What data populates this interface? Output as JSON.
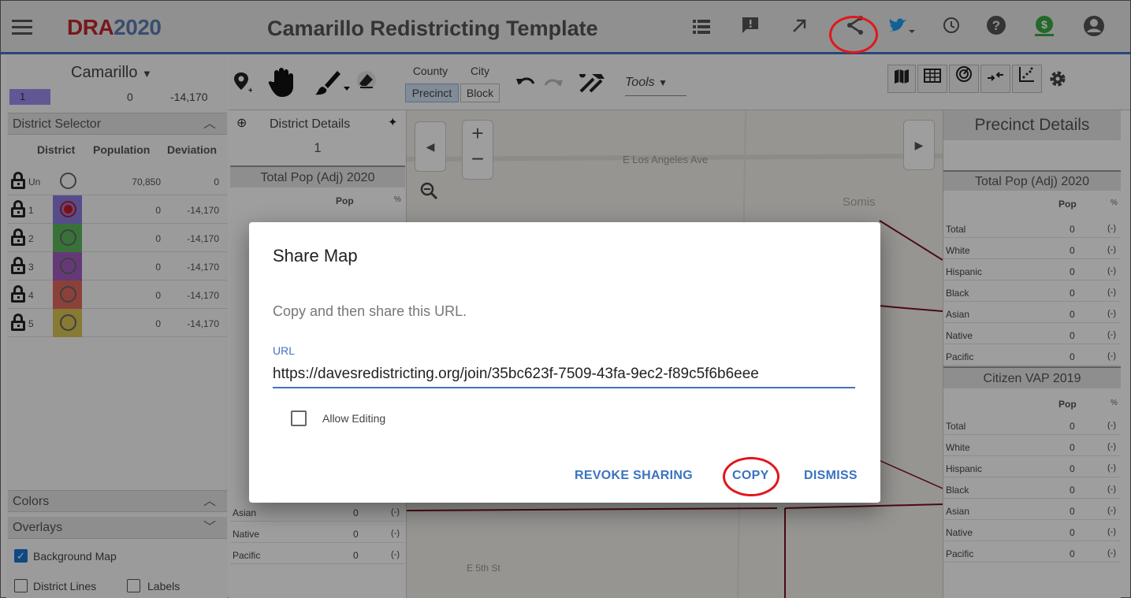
{
  "header": {
    "logo_dra": "DRA",
    "logo_year": "2020",
    "title": "Camarillo Redistricting Template",
    "icons": [
      "list-icon",
      "feedback-icon",
      "external-link-icon",
      "share-icon",
      "twitter-icon",
      "history-icon",
      "help-icon",
      "funding-icon",
      "account-icon"
    ],
    "accent_color": "#4472c4"
  },
  "left": {
    "plan_name": "Camarillo",
    "summary": {
      "district": "1",
      "population": "0",
      "deviation": "-14,170"
    },
    "district_selector_title": "District Selector",
    "columns": {
      "district": "District",
      "population": "Population",
      "deviation": "Deviation"
    },
    "rows": [
      {
        "label": "Un",
        "population": "70,850",
        "deviation": "0",
        "color": "#ffffff",
        "selected": false
      },
      {
        "label": "1",
        "population": "0",
        "deviation": "-14,170",
        "color": "#8c7be0",
        "selected": true
      },
      {
        "label": "2",
        "population": "0",
        "deviation": "-14,170",
        "color": "#5cb85c",
        "selected": false
      },
      {
        "label": "3",
        "population": "0",
        "deviation": "-14,170",
        "color": "#a45cc0",
        "selected": false
      },
      {
        "label": "4",
        "population": "0",
        "deviation": "-14,170",
        "color": "#e06a5e",
        "selected": false
      },
      {
        "label": "5",
        "population": "0",
        "deviation": "-14,170",
        "color": "#d9c655",
        "selected": false
      }
    ],
    "colors_label": "Colors",
    "overlays_label": "Overlays",
    "background_map_label": "Background Map",
    "district_lines_label": "District Lines",
    "labels_label": "Labels"
  },
  "toolbar": {
    "county": "County",
    "city": "City",
    "precinct": "Precinct",
    "block": "Block",
    "tools": "Tools"
  },
  "district_details": {
    "title": "District Details",
    "district": "1",
    "section_title": "Total Pop (Adj) 2020",
    "col_pop": "Pop",
    "col_pct": "%",
    "rows": [
      {
        "label": "Asian",
        "pop": "0",
        "pct": "(-)"
      },
      {
        "label": "Native",
        "pop": "0",
        "pct": "(-)"
      },
      {
        "label": "Pacific",
        "pop": "0",
        "pct": "(-)"
      }
    ]
  },
  "map": {
    "labels": [
      "E Los Angeles Ave",
      "Somis",
      "E 5th St"
    ]
  },
  "precinct_details": {
    "title": "Precinct Details",
    "section1": "Total Pop (Adj) 2020",
    "section2": "Citizen VAP 2019",
    "col_pop": "Pop",
    "col_pct": "%",
    "rows1": [
      {
        "label": "Total",
        "pop": "0",
        "pct": "(-)"
      },
      {
        "label": "White",
        "pop": "0",
        "pct": "(-)"
      },
      {
        "label": "Hispanic",
        "pop": "0",
        "pct": "(-)"
      },
      {
        "label": "Black",
        "pop": "0",
        "pct": "(-)"
      },
      {
        "label": "Asian",
        "pop": "0",
        "pct": "(-)"
      },
      {
        "label": "Native",
        "pop": "0",
        "pct": "(-)"
      },
      {
        "label": "Pacific",
        "pop": "0",
        "pct": "(-)"
      }
    ],
    "rows2": [
      {
        "label": "Total",
        "pop": "0",
        "pct": "(-)"
      },
      {
        "label": "White",
        "pop": "0",
        "pct": "(-)"
      },
      {
        "label": "Hispanic",
        "pop": "0",
        "pct": "(-)"
      },
      {
        "label": "Black",
        "pop": "0",
        "pct": "(-)"
      },
      {
        "label": "Asian",
        "pop": "0",
        "pct": "(-)"
      },
      {
        "label": "Native",
        "pop": "0",
        "pct": "(-)"
      },
      {
        "label": "Pacific",
        "pop": "0",
        "pct": "(-)"
      }
    ]
  },
  "dialog": {
    "title": "Share Map",
    "subtitle": "Copy and then share this URL.",
    "url_label": "URL",
    "url_value": "https://davesredistricting.org/join/35bc623f-7509-43fa-9ec2-f89c5f6b6eee",
    "allow_editing": "Allow Editing",
    "revoke": "REVOKE SHARING",
    "copy": "COPY",
    "dismiss": "DISMISS"
  }
}
